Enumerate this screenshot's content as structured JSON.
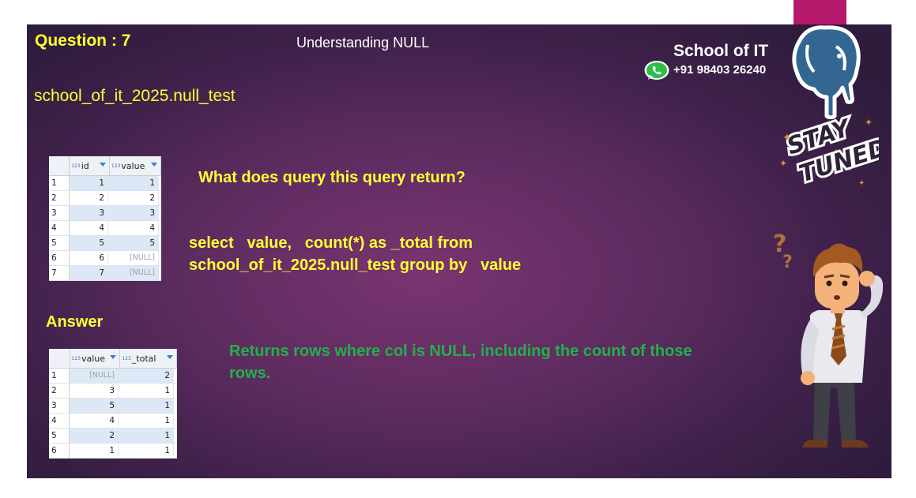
{
  "header": {
    "question_label": "Question : 7",
    "topic": "Understanding NULL",
    "table_name": "school_of_it_2025.null_test"
  },
  "brand": {
    "name": "School of IT",
    "phone": "+91 98403 26240"
  },
  "source_table": {
    "columns": [
      {
        "type_badge": "123",
        "name": "id"
      },
      {
        "type_badge": "123",
        "name": "value"
      }
    ],
    "rows": [
      {
        "n": "1",
        "id": "1",
        "value": "1"
      },
      {
        "n": "2",
        "id": "2",
        "value": "2"
      },
      {
        "n": "3",
        "id": "3",
        "value": "3"
      },
      {
        "n": "4",
        "id": "4",
        "value": "4"
      },
      {
        "n": "5",
        "id": "5",
        "value": "5"
      },
      {
        "n": "6",
        "id": "6",
        "value": "[NULL]"
      },
      {
        "n": "7",
        "id": "7",
        "value": "[NULL]"
      }
    ]
  },
  "question": "What does query this query return?",
  "query": {
    "line1": "select   value,   count(*) as _total from",
    "line2": "school_of_it_2025.null_test group by   value"
  },
  "answer": {
    "label": "Answer",
    "text": "Returns rows where col is NULL, including the count of those rows."
  },
  "result_table": {
    "columns": [
      {
        "type_badge": "123",
        "name": "value"
      },
      {
        "type_badge": "123",
        "name": "_total"
      }
    ],
    "rows": [
      {
        "n": "1",
        "value": "[NULL]",
        "total": "2"
      },
      {
        "n": "2",
        "value": "3",
        "total": "1"
      },
      {
        "n": "3",
        "value": "5",
        "total": "1"
      },
      {
        "n": "4",
        "value": "4",
        "total": "1"
      },
      {
        "n": "5",
        "value": "2",
        "total": "1"
      },
      {
        "n": "6",
        "value": "1",
        "total": "1"
      }
    ]
  },
  "stay_tuned": {
    "line1": "STAY",
    "line2": "TUNED"
  },
  "colors": {
    "accent_yellow": "#ffff33",
    "answer_green": "#22b04c",
    "tab_magenta": "#b5176a",
    "slide_purple": "#6b2e66"
  },
  "icons": [
    "whatsapp-icon",
    "postgresql-elephant-icon",
    "question-mark-icon",
    "confused-man-illustration"
  ]
}
